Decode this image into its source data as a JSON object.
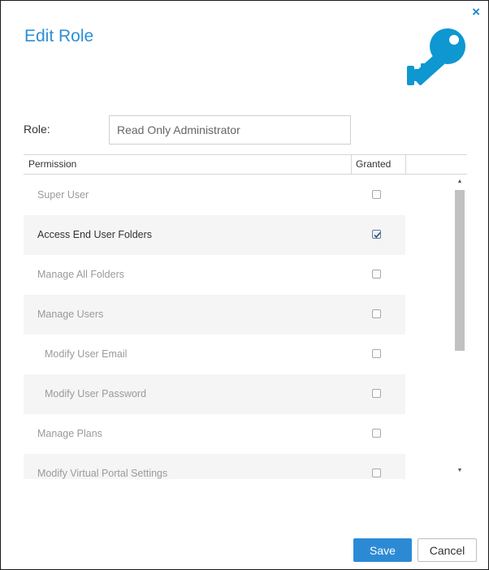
{
  "dialog": {
    "title": "Edit Role",
    "close_glyph": "×",
    "icon": "key-icon",
    "accent_color": "#2e8fd5"
  },
  "role": {
    "label": "Role:",
    "value": "Read Only Administrator"
  },
  "grid": {
    "columns": [
      "Permission",
      "Granted"
    ],
    "rows": [
      {
        "label": "Super User",
        "granted": false,
        "indent": 0,
        "enabled": false
      },
      {
        "label": "Access End User Folders",
        "granted": true,
        "indent": 0,
        "enabled": true
      },
      {
        "label": "Manage All Folders",
        "granted": false,
        "indent": 0,
        "enabled": false
      },
      {
        "label": "Manage Users",
        "granted": false,
        "indent": 0,
        "enabled": false
      },
      {
        "label": "Modify User Email",
        "granted": false,
        "indent": 1,
        "enabled": false
      },
      {
        "label": "Modify User Password",
        "granted": false,
        "indent": 1,
        "enabled": false
      },
      {
        "label": "Manage Plans",
        "granted": false,
        "indent": 0,
        "enabled": false
      },
      {
        "label": "Modify Virtual Portal Settings",
        "granted": false,
        "indent": 0,
        "enabled": false
      }
    ]
  },
  "buttons": {
    "save": "Save",
    "cancel": "Cancel"
  }
}
